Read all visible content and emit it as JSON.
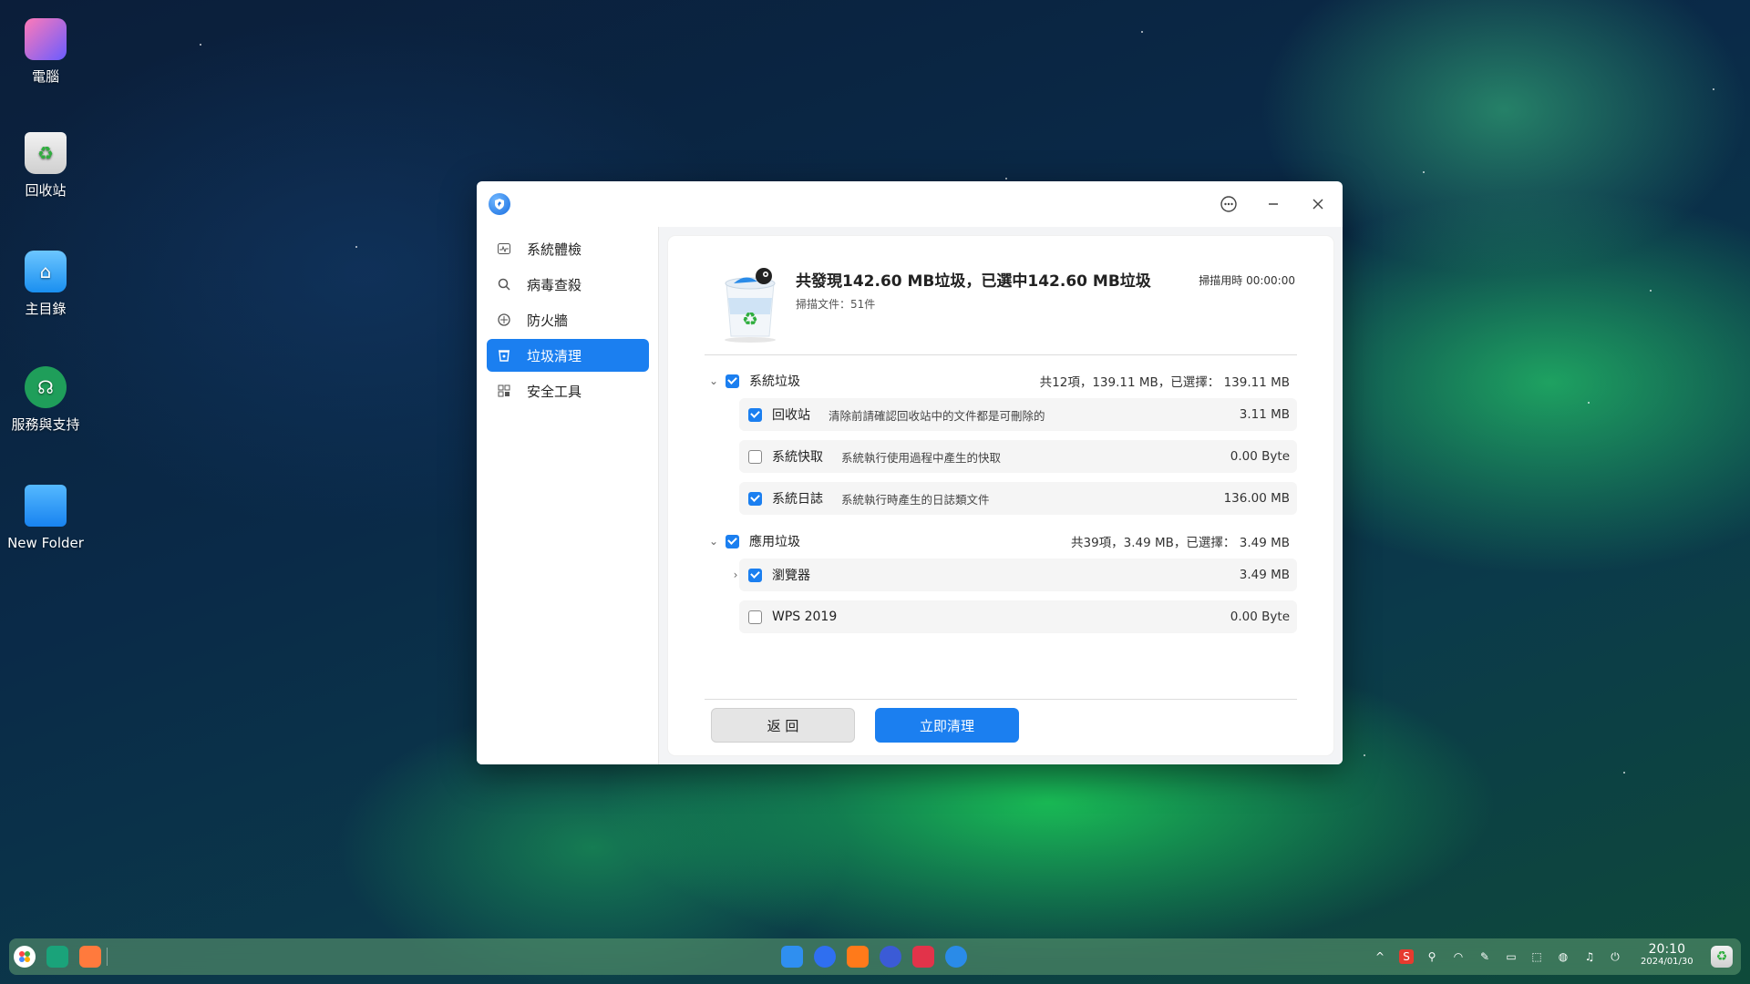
{
  "desktop": {
    "icons": [
      {
        "label": "電腦",
        "icon": "computer-icon"
      },
      {
        "label": "回收站",
        "icon": "trash-icon"
      },
      {
        "label": "主目錄",
        "icon": "home-folder-icon"
      },
      {
        "label": "服務與支持",
        "icon": "support-icon"
      },
      {
        "label": "New Folder",
        "icon": "folder-icon"
      }
    ]
  },
  "window": {
    "title_icon": "security-shield-icon",
    "controls": {
      "menu": "more-icon",
      "minimize": "minimize-icon",
      "close": "close-icon"
    },
    "sidebar": [
      {
        "label": "系統體檢",
        "icon": "checkup-icon",
        "active": false
      },
      {
        "label": "病毒查殺",
        "icon": "virus-scan-icon",
        "active": false
      },
      {
        "label": "防火牆",
        "icon": "firewall-icon",
        "active": false
      },
      {
        "label": "垃圾清理",
        "icon": "trash-clean-icon",
        "active": true
      },
      {
        "label": "安全工具",
        "icon": "tools-icon",
        "active": false
      }
    ],
    "header": {
      "title": "共發現142.60 MB垃圾，已選中142.60 MB垃圾",
      "scanned": "掃描文件：51件",
      "time": "掃描用時 00:00:00"
    },
    "groups": [
      {
        "label": "系統垃圾",
        "checked": true,
        "summary": "共12項，139.11 MB，已選擇： 139.11 MB",
        "items": [
          {
            "label": "回收站",
            "desc": "清除前請確認回收站中的文件都是可刪除的",
            "size": "3.11 MB",
            "checked": true
          },
          {
            "label": "系統快取",
            "desc": "系統執行使用過程中產生的快取",
            "size": "0.00 Byte",
            "checked": false
          },
          {
            "label": "系統日誌",
            "desc": "系統執行時產生的日誌類文件",
            "size": "136.00 MB",
            "checked": true
          }
        ]
      },
      {
        "label": "應用垃圾",
        "checked": true,
        "summary": "共39項，3.49 MB，已選擇： 3.49 MB",
        "items": [
          {
            "label": "瀏覽器",
            "desc": "",
            "size": "3.49 MB",
            "checked": true
          },
          {
            "label": "WPS 2019",
            "desc": "",
            "size": "0.00 Byte",
            "checked": false
          }
        ]
      }
    ],
    "buttons": {
      "back": "返 回",
      "clean": "立即清理"
    }
  },
  "taskbar": {
    "clock_time": "20:10",
    "clock_date": "2024/01/30"
  },
  "colors": {
    "accent": "#1b7ff0"
  }
}
